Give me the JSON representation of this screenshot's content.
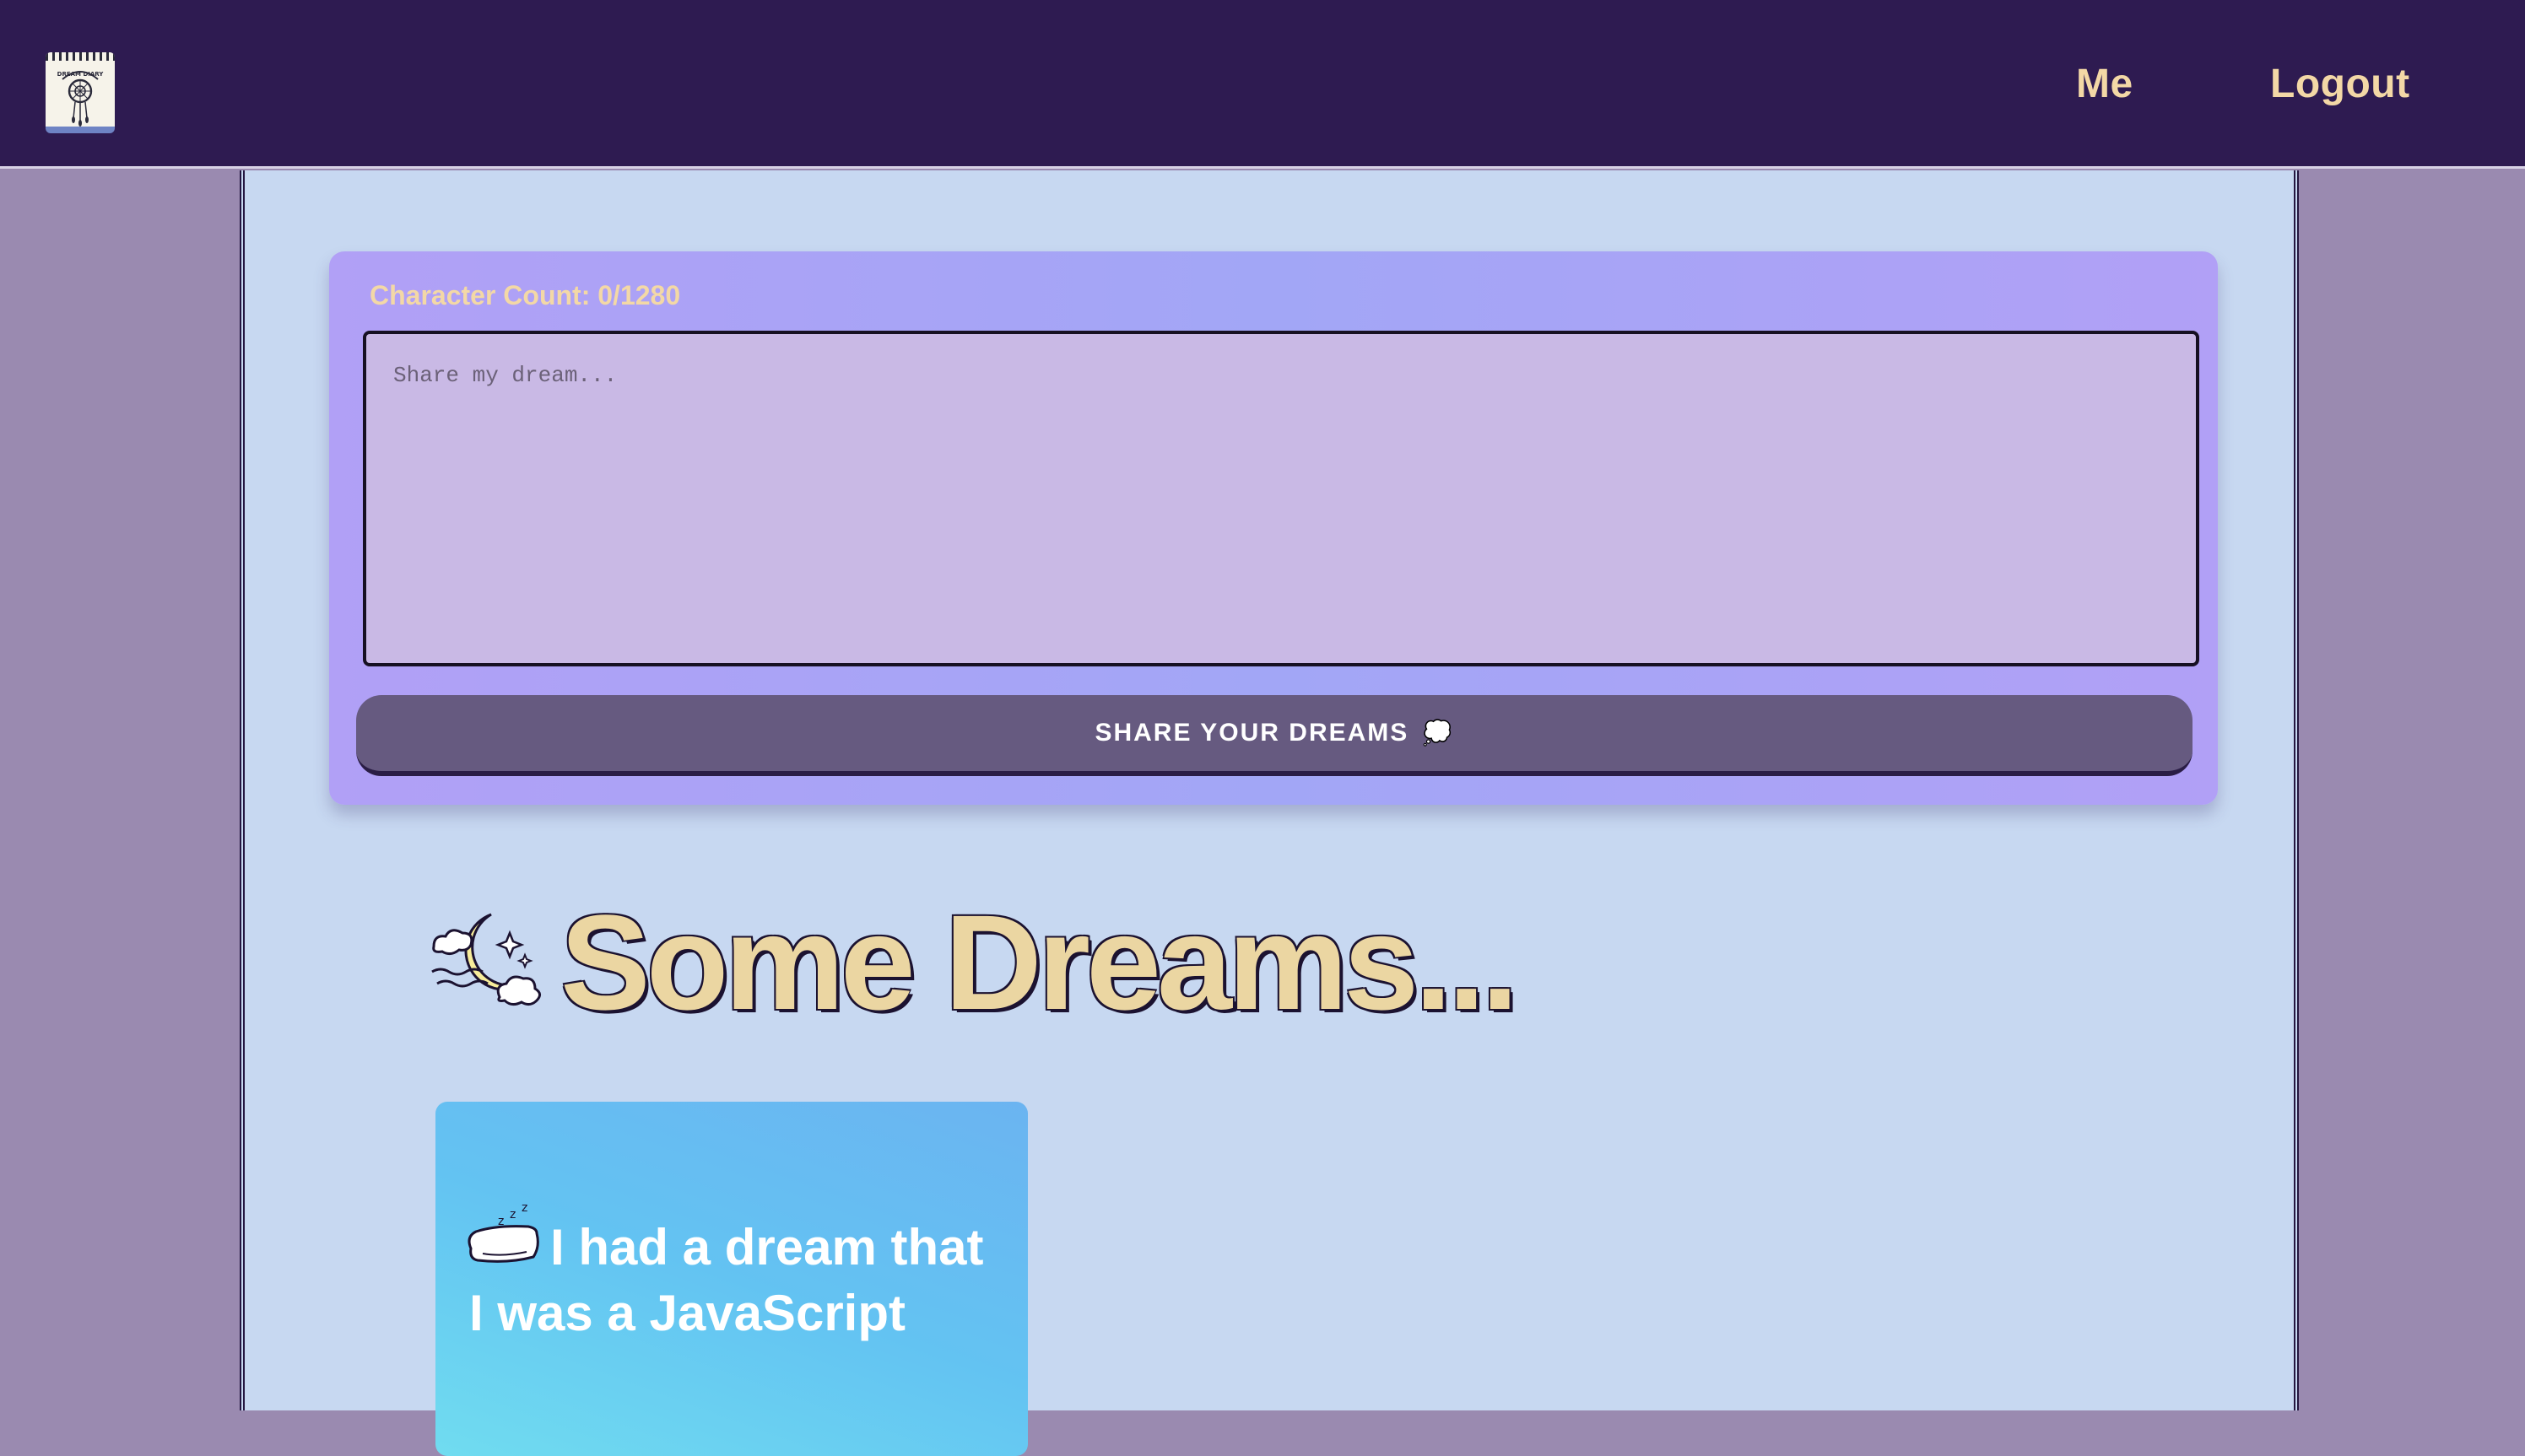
{
  "header": {
    "logo": {
      "icon": "dream-catcher-notebook-icon",
      "text": "DREAM DIARY"
    },
    "nav": [
      {
        "label": "Me"
      },
      {
        "label": "Logout"
      }
    ]
  },
  "dream_form": {
    "char_count_label": "Character Count: 0/1280",
    "input": {
      "placeholder": "Share my dream...",
      "value": ""
    },
    "submit_label": "SHARE YOUR DREAMS",
    "submit_icon": "thought-bubble-icon"
  },
  "dreams_section": {
    "title_icon": "crescent-moon-clouds-icon",
    "title": "Some Dreams...",
    "cards": [
      {
        "icon": "sleeping-pillow-icon",
        "text": "I had a dream that I was a JavaScript"
      }
    ]
  },
  "colors": {
    "header_bg": "#2e1b51",
    "accent_text": "#f3d8a6",
    "panel_bg": "#c7d8f1",
    "form_bg": "#a2a6f6",
    "button_bg": "#665a80",
    "card_bg": "#63c3f2"
  }
}
